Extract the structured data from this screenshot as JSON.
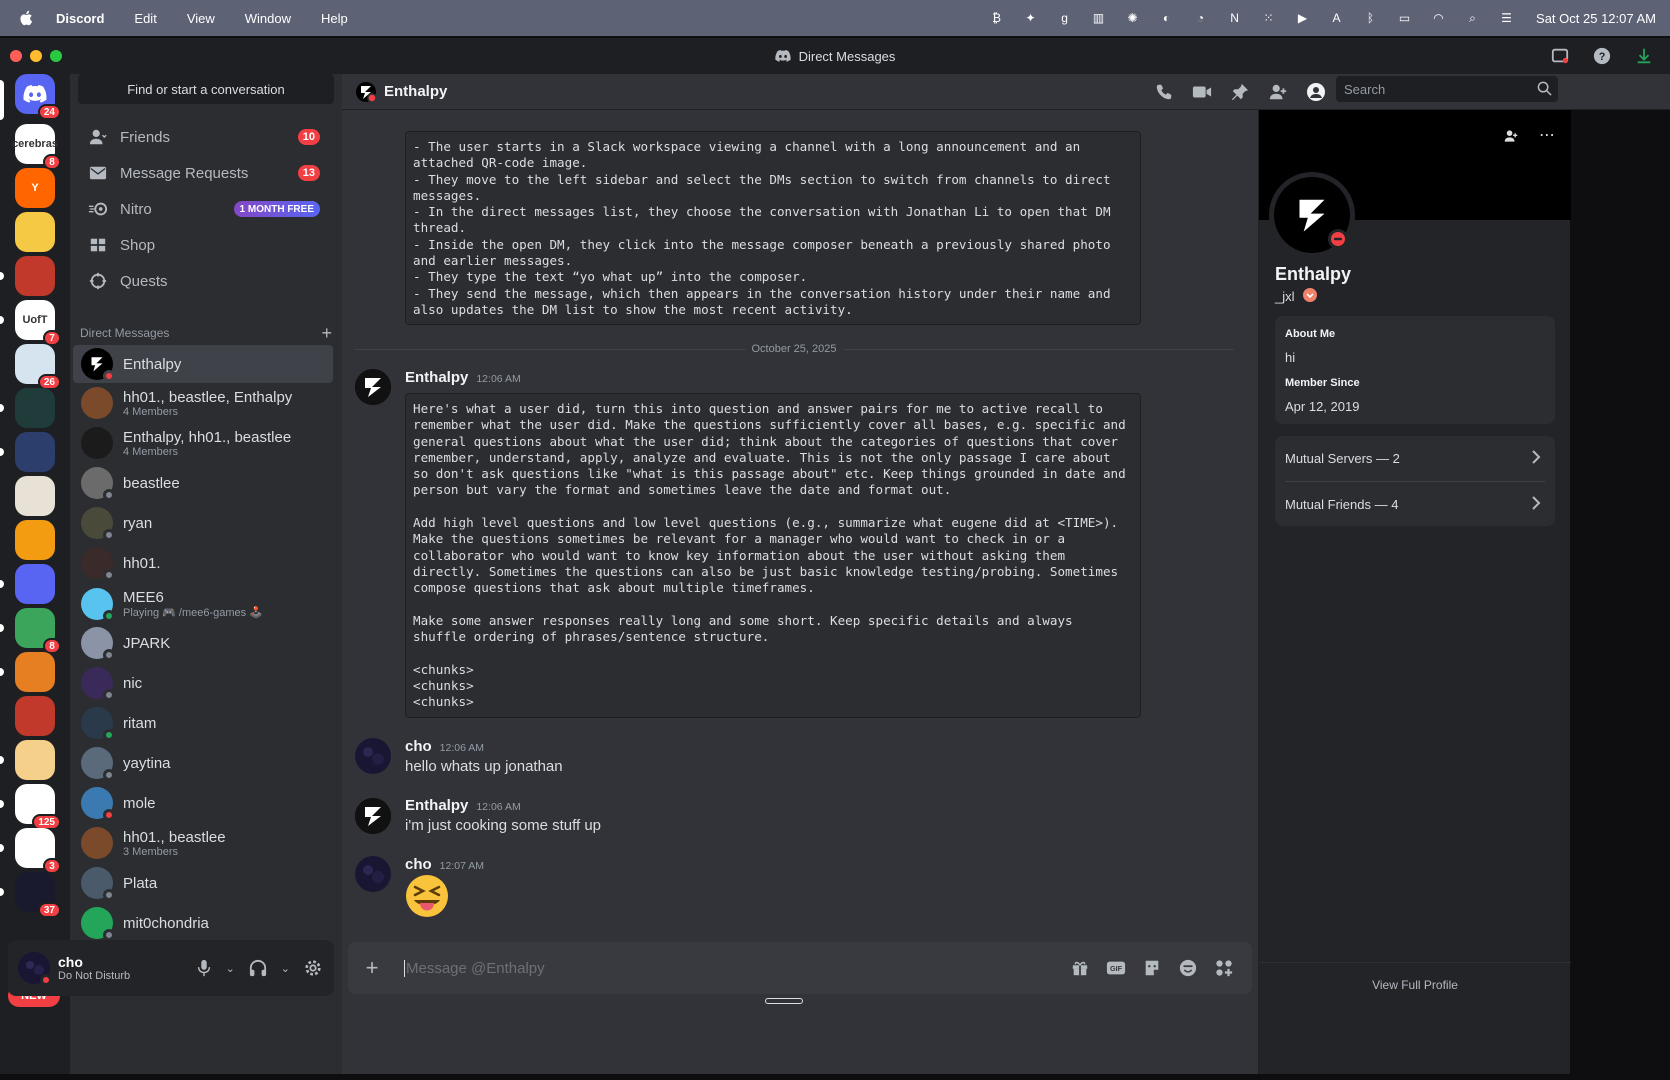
{
  "menubar": {
    "app_name": "Discord",
    "items": [
      "Edit",
      "View",
      "Window",
      "Help"
    ],
    "clock": "Sat Oct 25  12:07 AM"
  },
  "window": {
    "title": "Direct Messages"
  },
  "rail": {
    "home_badge": "24",
    "servers": [
      {
        "badge": "8",
        "label": "cerebras",
        "color": "#ffffff"
      },
      {
        "badge": "",
        "label": "Y",
        "color": "#ff6600"
      },
      {
        "badge": "",
        "label": "",
        "color": "#f6c945"
      },
      {
        "badge": "",
        "label": "",
        "color": "#c0392b"
      },
      {
        "badge": "7",
        "label": "UofT",
        "color": "#ffffff"
      },
      {
        "badge": "26",
        "label": "",
        "color": "#d6e4f0"
      },
      {
        "badge": "",
        "label": "",
        "color": "#1f3b3a"
      },
      {
        "badge": "",
        "label": "",
        "color": "#2c3e6b"
      },
      {
        "badge": "",
        "label": "",
        "color": "#e8e2d6"
      },
      {
        "badge": "",
        "label": "",
        "color": "#f39c12"
      },
      {
        "badge": "",
        "label": "",
        "color": "#5865f2"
      },
      {
        "badge": "8",
        "label": "",
        "color": "#3ba55c"
      },
      {
        "badge": "",
        "label": "",
        "color": "#e67e22"
      },
      {
        "badge": "",
        "label": "",
        "color": "#c0392b"
      },
      {
        "badge": "",
        "label": "",
        "color": "#f5d08a"
      },
      {
        "badge": "125",
        "label": "",
        "color": "#ffffff"
      },
      {
        "badge": "3",
        "label": "",
        "color": "#ffffff"
      },
      {
        "badge": "37",
        "label": "",
        "color": "#1a1a2e"
      }
    ],
    "new_label": "NEW"
  },
  "sidebar": {
    "find_label": "Find or start a conversation",
    "nav": [
      {
        "label": "Friends",
        "badge": "10"
      },
      {
        "label": "Message Requests",
        "badge": "13"
      },
      {
        "label": "Nitro",
        "promo": "1 MONTH FREE"
      },
      {
        "label": "Shop"
      },
      {
        "label": "Quests"
      }
    ],
    "dm_header": "Direct Messages",
    "dms": [
      {
        "name": "Enthalpy",
        "sub": "",
        "active": true
      },
      {
        "name": "hh01., beastlee, Enthalpy",
        "sub": "4 Members"
      },
      {
        "name": "Enthalpy, hh01., beastlee",
        "sub": "4 Members"
      },
      {
        "name": "beastlee",
        "sub": ""
      },
      {
        "name": "ryan",
        "sub": ""
      },
      {
        "name": "hh01.",
        "sub": ""
      },
      {
        "name": "MEE6",
        "sub": "Playing 🎮 /mee6-games 🕹️"
      },
      {
        "name": "JPARK",
        "sub": ""
      },
      {
        "name": "nic",
        "sub": ""
      },
      {
        "name": "ritam",
        "sub": ""
      },
      {
        "name": "yaytina",
        "sub": ""
      },
      {
        "name": "mole",
        "sub": ""
      },
      {
        "name": "hh01., beastlee",
        "sub": "3 Members"
      },
      {
        "name": "Plata",
        "sub": ""
      },
      {
        "name": "mit0chondria",
        "sub": ""
      }
    ]
  },
  "user": {
    "name": "cho",
    "status": "Do Not Disturb"
  },
  "chat": {
    "channel_name": "Enthalpy",
    "search_placeholder": "Search",
    "top_code": "- The user starts in a Slack workspace viewing a channel with a long announcement and an\nattached QR-code image.\n- They move to the left sidebar and select the DMs section to switch from channels to direct\nmessages.\n- In the direct messages list, they choose the conversation with Jonathan Li to open that DM\nthread.\n- Inside the open DM, they click into the message composer beneath a previously shared photo\nand earlier messages.\n- They type the text “yo what up” into the composer.\n- They send the message, which then appears in the conversation history under their name and\nalso updates the DM list to show the most recent activity.",
    "date_separator": "October 25, 2025",
    "messages": [
      {
        "author": "Enthalpy",
        "time": "12:06 AM",
        "code": "Here's what a user did, turn this into question and answer pairs for me to active recall to\nremember what the user did. Make the questions sufficiently cover all bases, e.g. specific and\ngeneral questions about what the user did; think about the categories of questions that cover\nremember, understand, apply, analyze and evaluate. This is not the only passage I care about\nso don't ask questions like \"what is this passage about\" etc. Keep things grounded in date and\nperson but vary the format and sometimes leave the date and format out.\n\nAdd high level questions and low level questions (e.g., summarize what eugene did at <TIME>).\nMake the questions sometimes be relevant for a manager who would want to check in or a\ncollaborator who would want to know key information about the user without asking them\ndirectly. Sometimes the questions can also be just basic knowledge testing/probing. Sometimes\ncompose questions that ask about multiple timeframes.\n\nMake some answer responses really long and some short. Keep specific details and always\nshuffle ordering of phrases/sentence structure.\n\n<chunks>\n<chunks>\n<chunks>"
      },
      {
        "author": "cho",
        "time": "12:06 AM",
        "text": "hello whats up jonathan"
      },
      {
        "author": "Enthalpy",
        "time": "12:06 AM",
        "text": "i'm just cooking some stuff up"
      },
      {
        "author": "cho",
        "time": "12:07 AM",
        "text": ""
      }
    ],
    "composer_placeholder": "Message @Enthalpy"
  },
  "profile": {
    "name": "Enthalpy",
    "handle": "_jxl",
    "about_label": "About Me",
    "about_value": "hi",
    "since_label": "Member Since",
    "since_value": "Apr 12, 2019",
    "mutual_servers": "Mutual Servers — 2",
    "mutual_friends": "Mutual Friends — 4",
    "view_full": "View Full Profile"
  },
  "colors": {
    "dnd": "#f23f43",
    "online": "#23a55a",
    "offline": "#80848e",
    "accent": "#5865f2"
  }
}
